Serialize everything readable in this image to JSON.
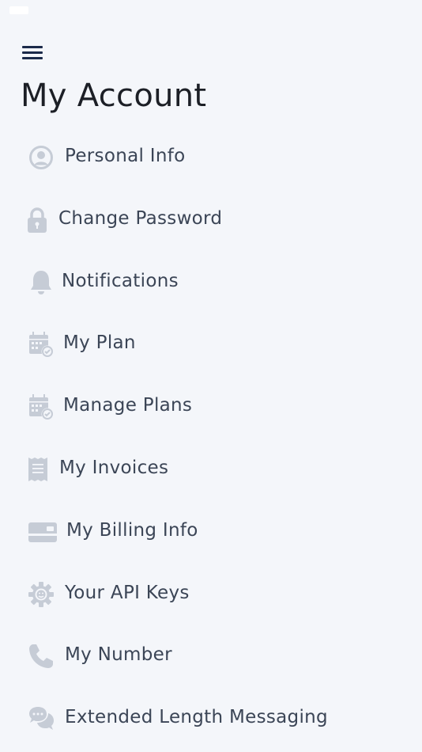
{
  "status_bar": {
    "time": "",
    "right_text": ""
  },
  "header": {
    "title": "My Account"
  },
  "menu": {
    "items": [
      {
        "label": "Personal Info",
        "icon": "user-circle-icon"
      },
      {
        "label": "Change Password",
        "icon": "lock-icon"
      },
      {
        "label": "Notifications",
        "icon": "bell-icon"
      },
      {
        "label": "My Plan",
        "icon": "calendar-icon"
      },
      {
        "label": "Manage Plans",
        "icon": "calendar-icon"
      },
      {
        "label": "My Invoices",
        "icon": "receipt-icon"
      },
      {
        "label": "My Billing Info",
        "icon": "credit-card-icon"
      },
      {
        "label": "Your API Keys",
        "icon": "gear-icon"
      },
      {
        "label": "My Number",
        "icon": "phone-icon"
      },
      {
        "label": "Extended Length Messaging",
        "icon": "chat-bubbles-icon"
      }
    ]
  },
  "colors": {
    "background": "#f4f6fa",
    "icon": "#c6ccd6",
    "label": "#3b4556",
    "title": "#1c1f26",
    "menu_button": "#1b2a4a"
  }
}
